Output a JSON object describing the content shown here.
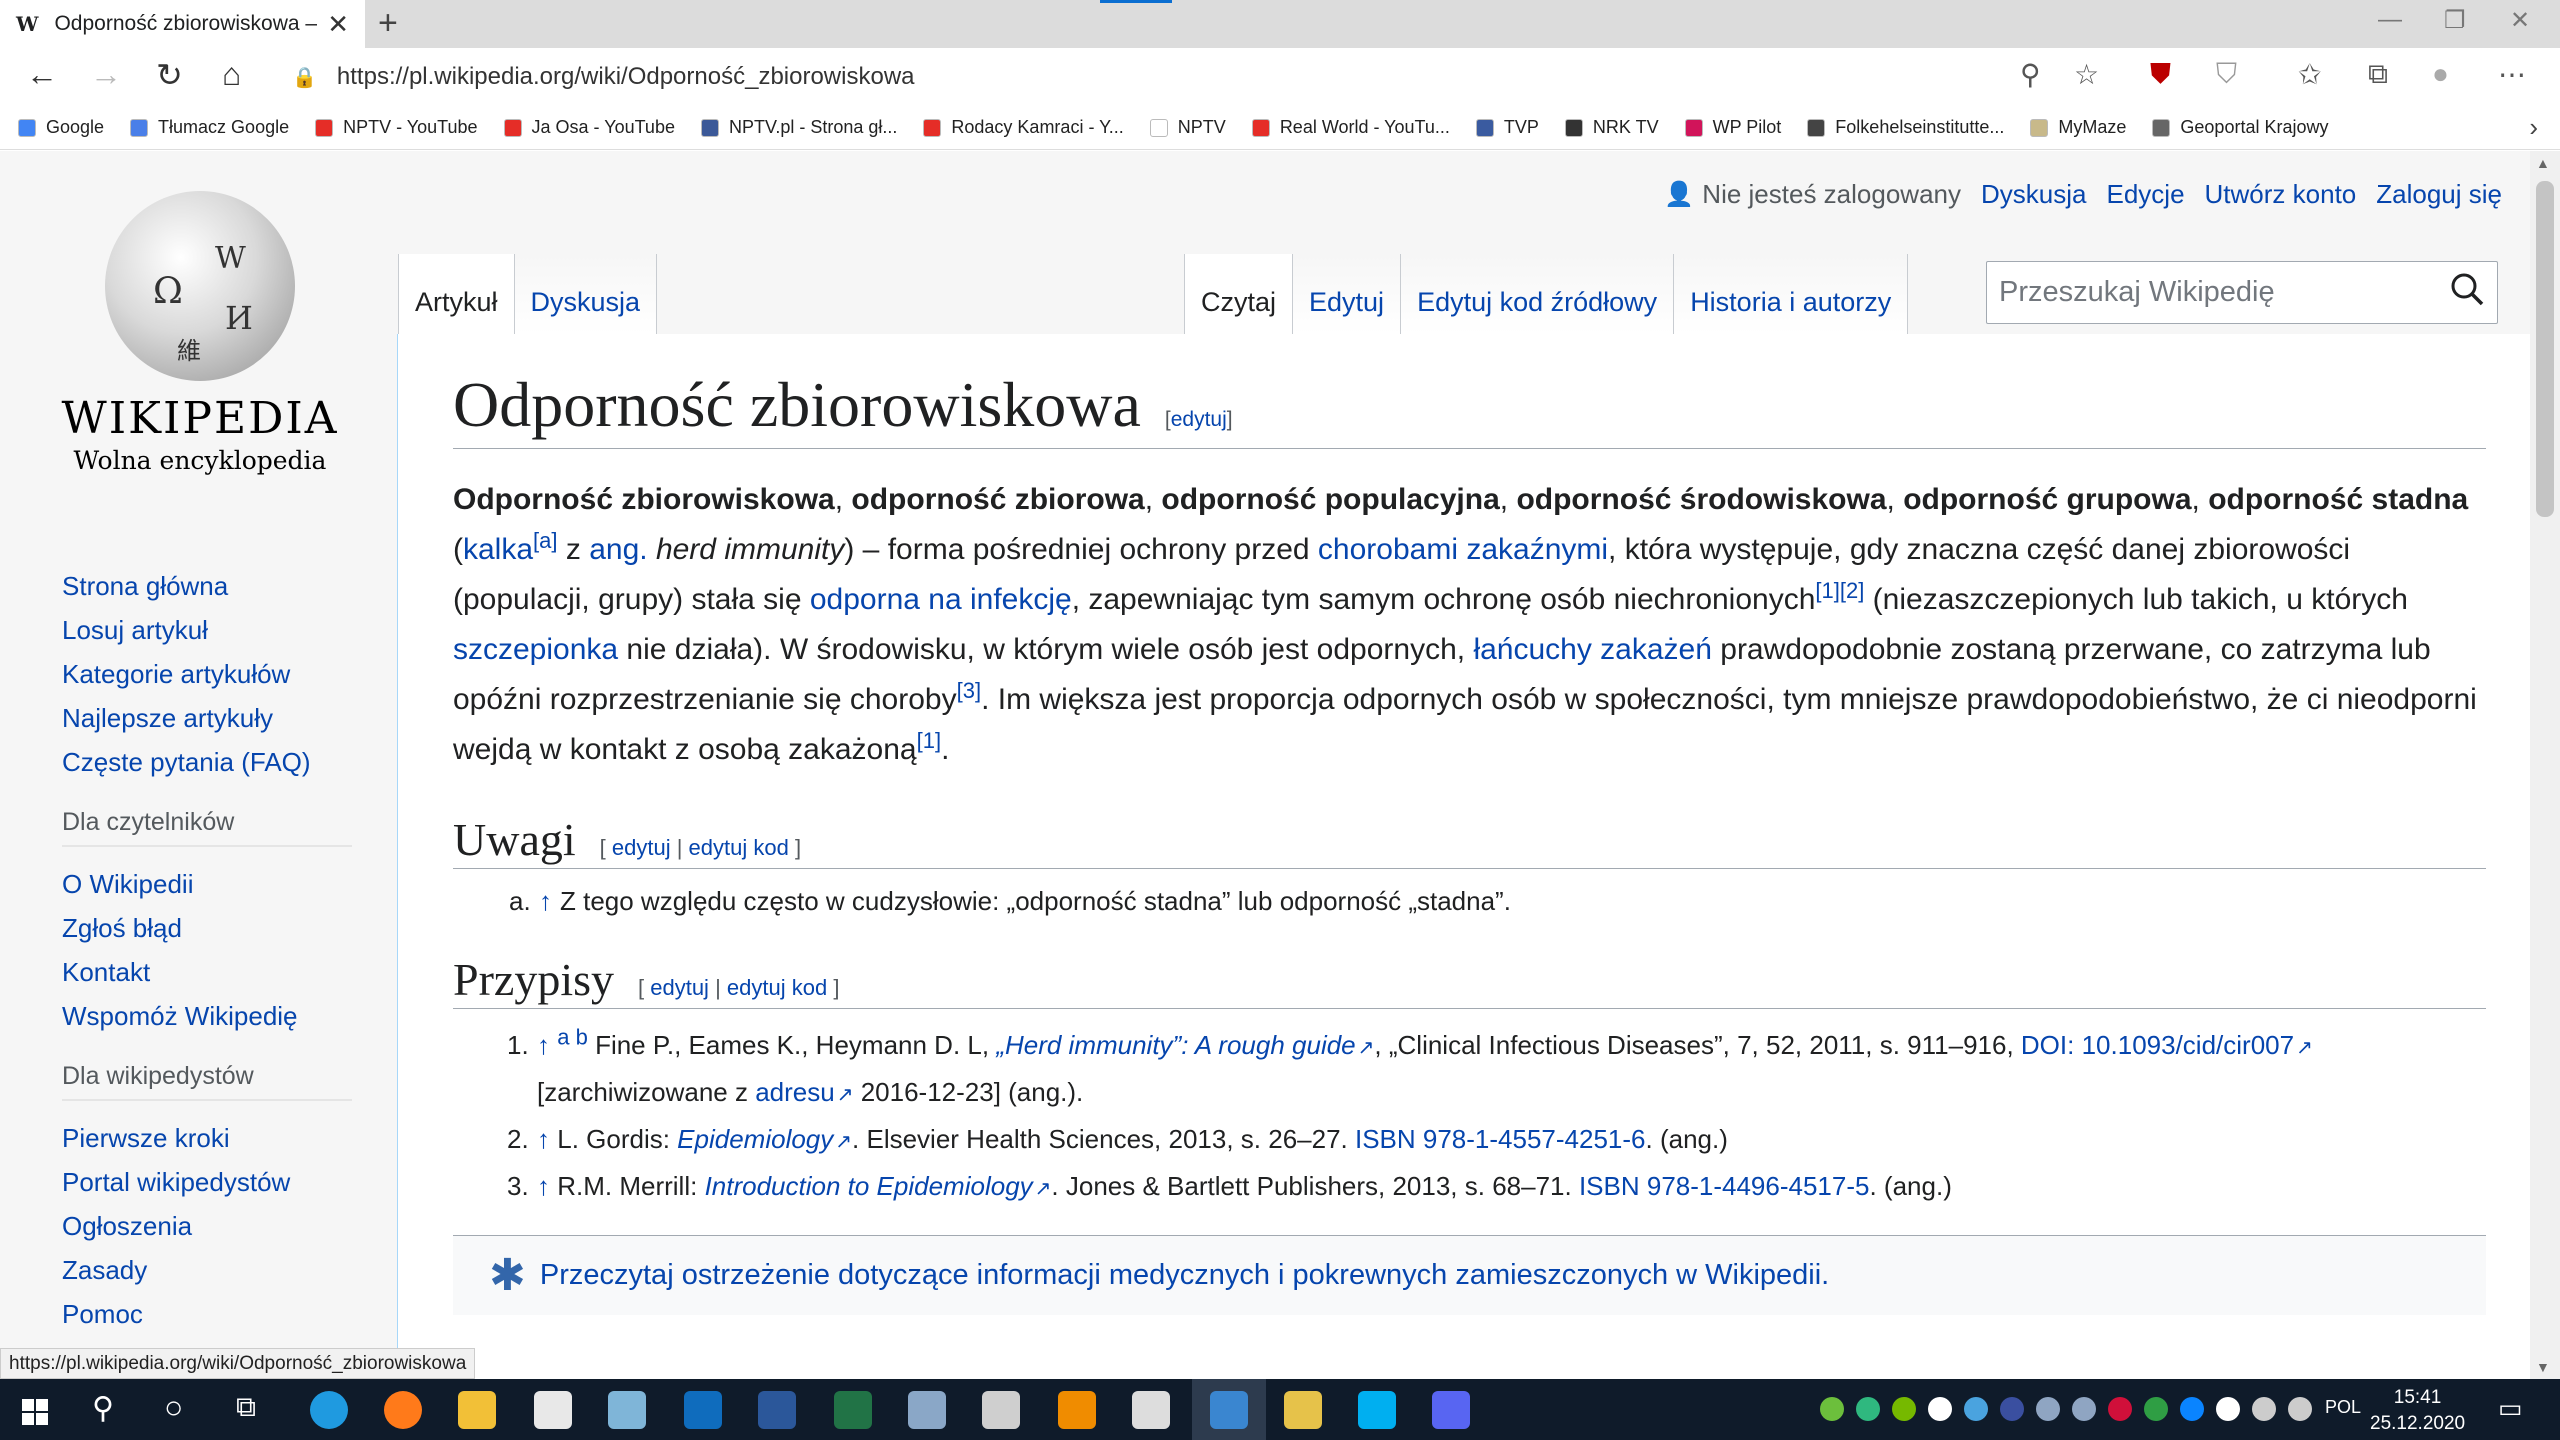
{
  "browser": {
    "tab_title": "Odporność zbiorowiskowa – Wik",
    "tab_favicon": "W",
    "url": "https://pl.wikipedia.org/wiki/Odporność_zbiorowiskowa",
    "status_url": "https://pl.wikipedia.org/wiki/Odporność_zbiorowiskowa",
    "bookmarks": [
      {
        "label": "Google",
        "color": "#4285f4"
      },
      {
        "label": "Tłumacz Google",
        "color": "#4a7fe8"
      },
      {
        "label": "NPTV - YouTube",
        "color": "#e52d27"
      },
      {
        "label": "Ja Osa - YouTube",
        "color": "#e52d27"
      },
      {
        "label": "NPTV.pl - Strona gł...",
        "color": "#3b5998"
      },
      {
        "label": "Rodacy Kamraci - Y...",
        "color": "#e52d27"
      },
      {
        "label": "NPTV",
        "color": "#ffffff"
      },
      {
        "label": "Real World - YouTu...",
        "color": "#e52d27"
      },
      {
        "label": "TVP",
        "color": "#3a5ba0"
      },
      {
        "label": "NRK TV",
        "color": "#333333"
      },
      {
        "label": "WP Pilot",
        "color": "#d1145a"
      },
      {
        "label": "Folkehelseinstitutte...",
        "color": "#444444"
      },
      {
        "label": "MyMaze",
        "color": "#c8b98a"
      },
      {
        "label": "Geoportal Krajowy",
        "color": "#666666"
      }
    ]
  },
  "wiki": {
    "wordmark": "WIKIPEDIA",
    "tagline": "Wolna encyklopedia",
    "personal": {
      "not_logged": "Nie jesteś zalogowany",
      "links": [
        "Dyskusja",
        "Edycje",
        "Utwórz konto",
        "Zaloguj się"
      ]
    },
    "tabs_left": [
      "Artykuł",
      "Dyskusja"
    ],
    "tabs_right": [
      "Czytaj",
      "Edytuj",
      "Edytuj kod źródłowy",
      "Historia i autorzy"
    ],
    "search_placeholder": "Przeszukaj Wikipedię",
    "nav_main": [
      "Strona główna",
      "Losuj artykuł",
      "Kategorie artykułów",
      "Najlepsze artykuły",
      "Częste pytania (FAQ)"
    ],
    "nav_readers_head": "Dla czytelników",
    "nav_readers": [
      "O Wikipedii",
      "Zgłoś błąd",
      "Kontakt",
      "Wspomóż Wikipedię"
    ],
    "nav_wikipedians_head": "Dla wikipedystów",
    "nav_wikipedians": [
      "Pierwsze kroki",
      "Portal wikipedystów",
      "Ogłoszenia",
      "Zasady",
      "Pomoc"
    ]
  },
  "article": {
    "title": "Odporność zbiorowiskowa",
    "edit_label": "edytuj",
    "edit_code_label": "edytuj kod",
    "lead": {
      "b1": "Odporność zbiorowiskowa",
      "b2": "odporność zbiorowa",
      "b3": "odporność populacyjna",
      "b4": "odporność środowiskowa",
      "b5": "odporność grupowa",
      "b6": "odporność stadna",
      "kalka": "kalka",
      "sup_a": "[a]",
      "z": "z",
      "ang": "ang.",
      "herd": "herd immunity",
      "t1": ") – forma pośredniej ochrony przed ",
      "choroby": "chorobami zakaźnymi",
      "t2": ", która występuje, gdy znaczna część danej zbiorowości (populacji, grupy) stała się ",
      "odporna": "odporna na infekcję",
      "t3": ", zapewniając tym samym ochronę osób niechronionych",
      "sup_1": "[1]",
      "sup_2": "[2]",
      "t4": " (niezaszczepionych lub takich, u których ",
      "szczepionka": "szczepionka",
      "t5": " nie działa). W środowisku, w którym wiele osób jest odpornych, ",
      "lancuchy": "łańcuchy zakażeń",
      "t6": " prawdopodobnie zostaną przerwane, co zatrzyma lub opóźni rozprzestrzenianie się choroby",
      "sup_3": "[3]",
      "t7": ". Im większa jest proporcja odpornych osób w społeczności, tym mniejsze prawdopodobieństwo, że ci nieodporni wejdą w kontakt z osobą zakażoną",
      "sup_1b": "[1]",
      "t8": "."
    },
    "uwagi": {
      "heading": "Uwagi",
      "note_a": "a.",
      "note_arrow": "↑",
      "note_text": "Z tego względu często w cudzysłowie: „odporność stadna” lub odporność „stadna”."
    },
    "przypisy": {
      "heading": "Przypisy",
      "refs": [
        {
          "n": "1.",
          "pre": "Fine P., Eames K., Heymann D. L, ",
          "link": "„Herd immunity”: A rough guide",
          "mid": ", „Clinical Infectious Diseases”, 7, 52, 2011, s. 911–916, ",
          "doi_label": "DOI:",
          "doi": "10.1093/cid/cir007",
          "arch_pre": "[zarchiwizowane z ",
          "arch_link": "adresu",
          "arch_post": " 2016-12-23] (ang.)."
        },
        {
          "n": "2.",
          "pre": "L. Gordis: ",
          "link": "Epidemiology",
          "mid": ". Elsevier Health Sciences, 2013, s. 26–27. ",
          "isbn": "ISBN 978-1-4557-4251-6",
          "post": ". (ang.)"
        },
        {
          "n": "3.",
          "pre": "R.M. Merrill: ",
          "link": "Introduction to Epidemiology",
          "mid": ". Jones & Bartlett Publishers, 2013, s. 68–71. ",
          "isbn": "ISBN 978-1-4496-4517-5",
          "post": ". (ang.)"
        }
      ]
    },
    "medical_warning": "Przeczytaj ostrzeżenie dotyczące informacji medycznych i pokrewnych zamieszczonych w Wikipedii."
  },
  "taskbar": {
    "lang": "POL",
    "time": "15:41",
    "date": "25.12.2020"
  }
}
